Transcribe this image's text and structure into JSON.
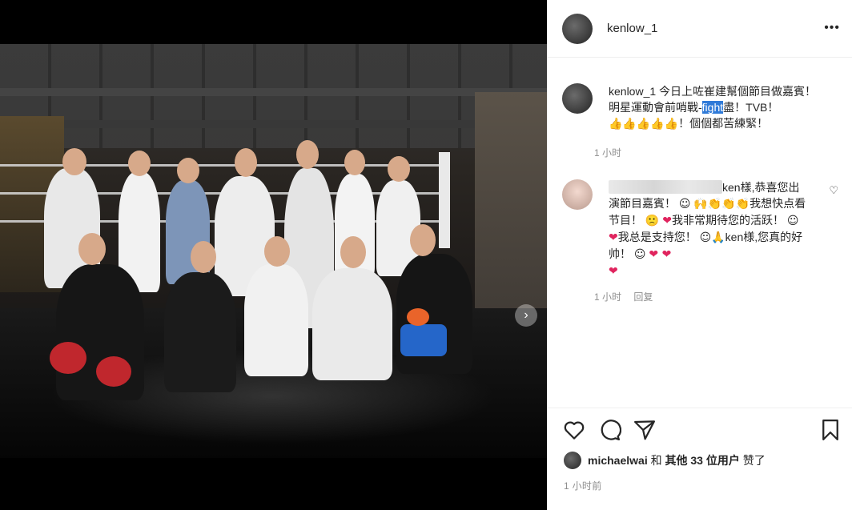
{
  "post": {
    "author": "kenlow_1",
    "photo_alt": "",
    "carousel_next": "›"
  },
  "header": {
    "more": "•••"
  },
  "caption": {
    "username": "kenlow_1",
    "text_before": " 今日上咗崔建幫個節目做嘉賓！明星運動會前哨戰-",
    "highlight": "fight",
    "text_after": "盡！TVB！",
    "thumbs": "👍👍👍👍👍",
    "text_end": "！個個都苦練緊！",
    "time": "1 小时"
  },
  "comment": {
    "text_a": "ken樣,恭喜您出演節目嘉賓！",
    "emoji_a": "☺",
    "emoji_b": "🙌",
    "emoji_c": "👏👏👏",
    "text_b": "我想快点看节目！",
    "emoji_d": "🙁",
    "heart1": "❤",
    "text_c": "我非常期待您的活跃！",
    "emoji_e": "☺",
    "heart2": "❤",
    "text_d": "我总是支持您！",
    "emoji_f": "☺",
    "emoji_g": "🙏",
    "text_e": "ken様,您真的好帅！",
    "emoji_h": "☺",
    "hearts": "❤ ❤",
    "heart_last": "❤",
    "time": "1 小时",
    "reply": "回复",
    "like_icon": "♡"
  },
  "actions": {
    "liked_by_user": "michaelwai",
    "and": "和",
    "others": "其他 33 位用户",
    "liked": "赞了",
    "posted": "1 小时前"
  },
  "icons": [
    "more-icon",
    "carousel-next-icon",
    "heart-icon",
    "comment-icon",
    "share-icon",
    "bookmark-icon"
  ]
}
